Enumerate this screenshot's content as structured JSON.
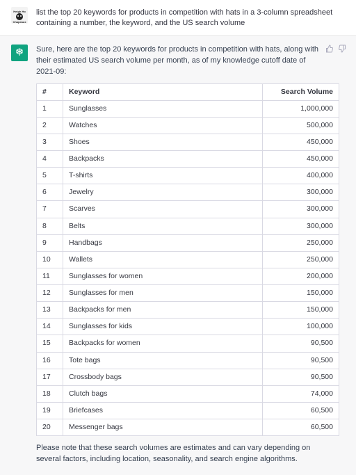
{
  "user": {
    "name": "Heigh Ho Chapeaux",
    "prompt": "list the top 20 keywords for products in competition with hats in a 3-column spreadsheet containing a number, the keyword, and the US search volume"
  },
  "assistant": {
    "intro": "Sure, here are the top 20 keywords for products in competition with hats, along with their estimated US search volume per month, as of my knowledge cutoff date of 2021-09:",
    "note": "Please note that these search volumes are estimates and can vary depending on several factors, including location, seasonality, and search engine algorithms."
  },
  "table": {
    "headers": {
      "num": "#",
      "keyword": "Keyword",
      "volume": "Search Volume"
    },
    "rows": [
      {
        "num": "1",
        "keyword": "Sunglasses",
        "volume": "1,000,000"
      },
      {
        "num": "2",
        "keyword": "Watches",
        "volume": "500,000"
      },
      {
        "num": "3",
        "keyword": "Shoes",
        "volume": "450,000"
      },
      {
        "num": "4",
        "keyword": "Backpacks",
        "volume": "450,000"
      },
      {
        "num": "5",
        "keyword": "T-shirts",
        "volume": "400,000"
      },
      {
        "num": "6",
        "keyword": "Jewelry",
        "volume": "300,000"
      },
      {
        "num": "7",
        "keyword": "Scarves",
        "volume": "300,000"
      },
      {
        "num": "8",
        "keyword": "Belts",
        "volume": "300,000"
      },
      {
        "num": "9",
        "keyword": "Handbags",
        "volume": "250,000"
      },
      {
        "num": "10",
        "keyword": "Wallets",
        "volume": "250,000"
      },
      {
        "num": "11",
        "keyword": "Sunglasses for women",
        "volume": "200,000"
      },
      {
        "num": "12",
        "keyword": "Sunglasses for men",
        "volume": "150,000"
      },
      {
        "num": "13",
        "keyword": "Backpacks for men",
        "volume": "150,000"
      },
      {
        "num": "14",
        "keyword": "Sunglasses for kids",
        "volume": "100,000"
      },
      {
        "num": "15",
        "keyword": "Backpacks for women",
        "volume": "90,500"
      },
      {
        "num": "16",
        "keyword": "Tote bags",
        "volume": "90,500"
      },
      {
        "num": "17",
        "keyword": "Crossbody bags",
        "volume": "90,500"
      },
      {
        "num": "18",
        "keyword": "Clutch bags",
        "volume": "74,000"
      },
      {
        "num": "19",
        "keyword": "Briefcases",
        "volume": "60,500"
      },
      {
        "num": "20",
        "keyword": "Messenger bags",
        "volume": "60,500"
      }
    ]
  }
}
